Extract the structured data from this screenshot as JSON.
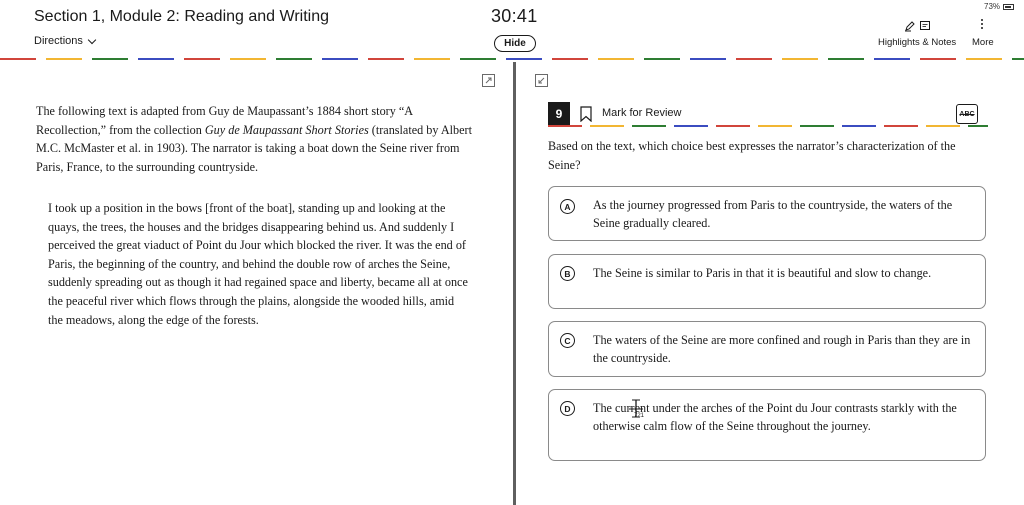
{
  "header": {
    "section_title": "Section 1, Module 2: Reading and Writing",
    "directions_label": "Directions",
    "timer": "30:41",
    "hide_label": "Hide",
    "battery_percent": "73%",
    "highlights_label": "Highlights & Notes",
    "more_label": "More"
  },
  "passage": {
    "intro_part1": "The following text is adapted from Guy de Maupassant’s 1884 short story “A Recollection,” from the collection ",
    "intro_italic": "Guy de Maupassant Short Stories",
    "intro_part2": " (translated by Albert M.C. McMaster et al. in 1903). The narrator is taking a boat down the Seine river from Paris, France, to the surrounding countryside.",
    "body": "I took up a position in the bows [front of the boat], standing up and looking at the quays, the trees, the houses and the bridges disappearing behind us. And suddenly I perceived the great viaduct of Point du Jour which blocked the river. It was the end of Paris, the beginning of the country, and behind the double row of arches the Seine, suddenly spreading out as though it had regained space and liberty, became all at once the peaceful river which flows through the plains, alongside the wooded hills, amid the meadows, along the edge of the forests."
  },
  "question": {
    "number": "9",
    "mark_for_review_label": "Mark for Review",
    "abc_label": "ABC",
    "text": "Based on the text, which choice best expresses the narrator’s characterization of the Seine?",
    "choices": [
      {
        "letter": "A",
        "text": "As the journey progressed from Paris to the countryside, the waters of the Seine gradually cleared."
      },
      {
        "letter": "B",
        "text": "The Seine is similar to Paris in that it is beautiful and slow to change."
      },
      {
        "letter": "C",
        "text": "The waters of the Seine are more confined and rough in Paris than they are in the countryside."
      },
      {
        "letter": "D",
        "text": "The current under the arches of the Point du Jour contrasts starkly with the otherwise calm flow of the Seine throughout the journey."
      }
    ]
  },
  "cursor_readout": "721",
  "colors": {
    "accent_dash": [
      "#d1453b",
      "#f2b632",
      "#2e7d32",
      "#3b4cc0"
    ],
    "divider": "#5f5f5f",
    "choice_border": "#8a8a8a"
  }
}
